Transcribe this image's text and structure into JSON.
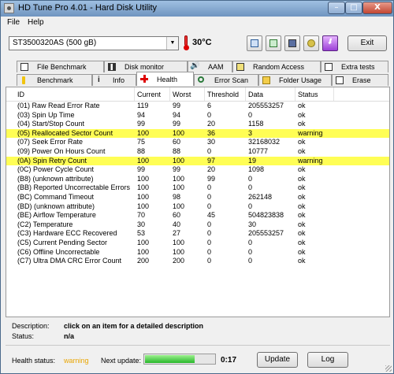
{
  "window": {
    "title": "HD Tune Pro 4.01 - Hard Disk Utility",
    "buttons": {
      "minimize": "–",
      "maximize": "□",
      "close": "X"
    }
  },
  "menu": {
    "file": "File",
    "help": "Help"
  },
  "toolbar": {
    "drive": "ST3500320AS (500 gB)",
    "temperature": "30°C",
    "exit": "Exit"
  },
  "tabs": {
    "row1": [
      "File Benchmark",
      "Disk monitor",
      "AAM",
      "Random Access",
      "Extra tests"
    ],
    "row2": [
      "Benchmark",
      "Info",
      "Health",
      "Error Scan",
      "Folder Usage",
      "Erase"
    ],
    "active": "Health"
  },
  "table": {
    "columns": [
      "ID",
      "Current",
      "Worst",
      "Threshold",
      "Data",
      "Status"
    ],
    "rows": [
      [
        "(01) Raw Read Error Rate",
        "119",
        "99",
        "6",
        "205553257",
        "ok"
      ],
      [
        "(03) Spin Up Time",
        "94",
        "94",
        "0",
        "0",
        "ok"
      ],
      [
        "(04) Start/Stop Count",
        "99",
        "99",
        "20",
        "1158",
        "ok"
      ],
      [
        "(05) Reallocated Sector Count",
        "100",
        "100",
        "36",
        "3",
        "warning"
      ],
      [
        "(07) Seek Error Rate",
        "75",
        "60",
        "30",
        "32168032",
        "ok"
      ],
      [
        "(09) Power On Hours Count",
        "88",
        "88",
        "0",
        "10777",
        "ok"
      ],
      [
        "(0A) Spin Retry Count",
        "100",
        "100",
        "97",
        "19",
        "warning"
      ],
      [
        "(0C) Power Cycle Count",
        "99",
        "99",
        "20",
        "1098",
        "ok"
      ],
      [
        "(B8) (unknown attribute)",
        "100",
        "100",
        "99",
        "0",
        "ok"
      ],
      [
        "(BB) Reported Uncorrectable Errors",
        "100",
        "100",
        "0",
        "0",
        "ok"
      ],
      [
        "(BC) Command Timeout",
        "100",
        "98",
        "0",
        "262148",
        "ok"
      ],
      [
        "(BD) (unknown attribute)",
        "100",
        "100",
        "0",
        "0",
        "ok"
      ],
      [
        "(BE) Airflow Temperature",
        "70",
        "60",
        "45",
        "504823838",
        "ok"
      ],
      [
        "(C2) Temperature",
        "30",
        "40",
        "0",
        "30",
        "ok"
      ],
      [
        "(C3) Hardware ECC Recovered",
        "53",
        "27",
        "0",
        "205553257",
        "ok"
      ],
      [
        "(C5) Current Pending Sector",
        "100",
        "100",
        "0",
        "0",
        "ok"
      ],
      [
        "(C6) Offline Uncorrectable",
        "100",
        "100",
        "0",
        "0",
        "ok"
      ],
      [
        "(C7) Ultra DMA CRC Error Count",
        "200",
        "200",
        "0",
        "0",
        "ok"
      ]
    ]
  },
  "details": {
    "description_label": "Description:",
    "description_value": "click on an item for a detailed description",
    "status_label": "Status:",
    "status_value": "n/a"
  },
  "footer": {
    "health_label": "Health status:",
    "health_value": "warning",
    "next_update_label": "Next update:",
    "progress": 0.72,
    "timer": "0:17",
    "update_button": "Update",
    "log_button": "Log"
  },
  "colors": {
    "warning_row": "#fffe55",
    "health_warning_text": "#e9a500"
  }
}
